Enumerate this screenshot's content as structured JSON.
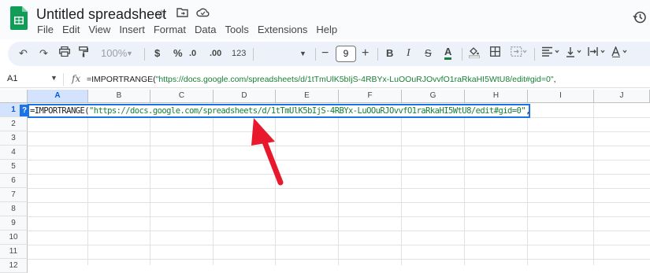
{
  "app": {
    "doc_title": "Untitled spreadsheet",
    "menu": [
      "File",
      "Edit",
      "View",
      "Insert",
      "Format",
      "Data",
      "Tools",
      "Extensions",
      "Help"
    ]
  },
  "toolbar": {
    "zoom": "100%",
    "currency": "$",
    "percent": "%",
    "decrease_decimal": ".0",
    "increase_decimal": ".00",
    "number_format": "123",
    "font_size": "9",
    "bold": "B",
    "italic": "I",
    "text_color": "A",
    "minus": "−",
    "plus": "+"
  },
  "formula_bar": {
    "name_box": "A1",
    "fx": "fx",
    "formula_prefix": "=IMPORTRANGE(",
    "formula_string": "\"https://docs.google.com/spreadsheets/d/1tTmUlK5bIjS-4RBYx-LuOOuRJOvvfO1raRkaHI5WtU8/edit#gid=0\"",
    "formula_suffix": ","
  },
  "grid": {
    "columns": [
      "A",
      "B",
      "C",
      "D",
      "E",
      "F",
      "G",
      "H",
      "I",
      "J"
    ],
    "rows": [
      "1",
      "2",
      "3",
      "4",
      "5",
      "6",
      "7",
      "8",
      "9",
      "10",
      "11",
      "12"
    ],
    "active_cell": "A1",
    "help_badge": "?",
    "cell_prefix": "=IMPORTRANGE(",
    "cell_string": "\"https://docs.google.com/spreadsheets/d/1tTmUlK5bIjS-4RBYx-LuOOuRJOvvfO1raRkaHI5WtU8/edit#gid=0\"",
    "cell_suffix": ","
  },
  "colors": {
    "accent": "#1a73e8",
    "string_green": "#188038",
    "arrow_red": "#e8192c"
  }
}
